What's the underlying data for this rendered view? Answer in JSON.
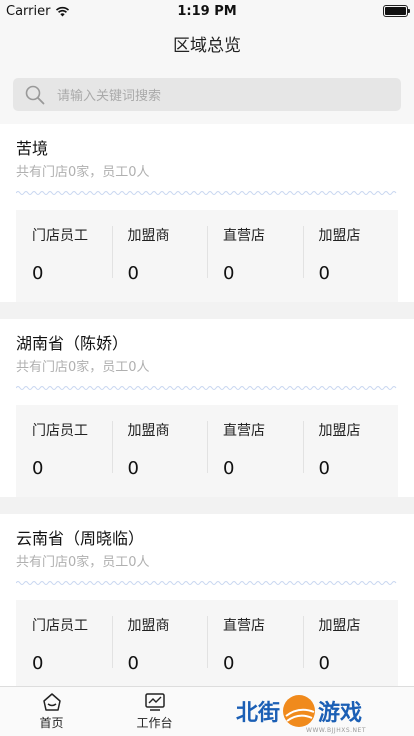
{
  "status": {
    "carrier": "Carrier",
    "time": "1:19 PM"
  },
  "header": {
    "title": "区域总览"
  },
  "search": {
    "placeholder": "请输入关键词搜索"
  },
  "regions": [
    {
      "title": "苦境",
      "summary": "共有门店0家，员工0人",
      "stats": [
        {
          "label": "门店员工",
          "value": "0"
        },
        {
          "label": "加盟商",
          "value": "0"
        },
        {
          "label": "直营店",
          "value": "0"
        },
        {
          "label": "加盟店",
          "value": "0"
        }
      ]
    },
    {
      "title": "湖南省（陈娇）",
      "summary": "共有门店0家，员工0人",
      "stats": [
        {
          "label": "门店员工",
          "value": "0"
        },
        {
          "label": "加盟商",
          "value": "0"
        },
        {
          "label": "直营店",
          "value": "0"
        },
        {
          "label": "加盟店",
          "value": "0"
        }
      ]
    },
    {
      "title": "云南省（周晓临）",
      "summary": "共有门店0家，员工0人",
      "stats": [
        {
          "label": "门店员工",
          "value": "0"
        },
        {
          "label": "加盟商",
          "value": "0"
        },
        {
          "label": "直营店",
          "value": "0"
        },
        {
          "label": "加盟店",
          "value": "0"
        }
      ]
    }
  ],
  "tabs": [
    {
      "label": "首页",
      "icon": "home-icon"
    },
    {
      "label": "工作台",
      "icon": "workbench-icon"
    }
  ],
  "watermark": {
    "left": "北街",
    "right": "游戏",
    "small": "WWW.BJJHXS.NET"
  },
  "colors": {
    "accent": "#1a6ec7",
    "watermark_orange": "#f08a1c",
    "watermark_blue": "#1b5fb5"
  }
}
